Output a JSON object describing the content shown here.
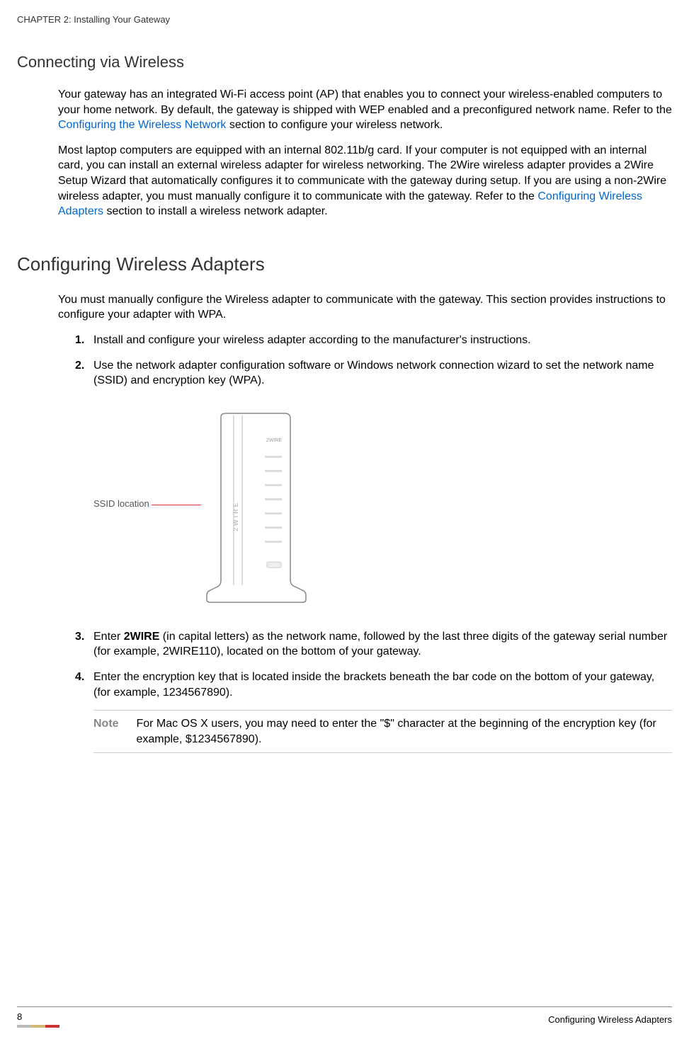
{
  "header": {
    "chapter": "CHAPTER 2: Installing Your Gateway"
  },
  "section1": {
    "title": "Connecting via Wireless",
    "para1_a": "Your gateway has an integrated Wi-Fi access point (AP) that enables you to connect your wireless-enabled computers to your home network. By default, the gateway is shipped with WEP enabled and a preconfigured network name. Refer to the ",
    "para1_link": "Configuring the Wireless Network",
    "para1_b": " section to configure your wireless network.",
    "para2_a": "Most laptop computers are equipped with an internal 802.11b/g card. If your computer is not equipped with an internal card, you can install an external wireless adapter for wireless networking. The 2Wire wireless adapter provides a 2Wire Setup Wizard that automatically configures it to communicate with the gateway during setup. If you are using a non-2Wire wireless adapter, you must manually configure it to communicate with the gateway. Refer to the ",
    "para2_link": "Configuring Wireless Adapters",
    "para2_b": " section to install a wireless network adapter."
  },
  "section2": {
    "title": "Configuring Wireless Adapters",
    "intro": "You must manually configure the Wireless adapter to communicate with the gateway. This section provides instructions to configure your adapter with WPA.",
    "steps": {
      "s1": "Install and configure your wireless adapter according to the manufacturer's instructions.",
      "s2": "Use the network adapter configuration software or Windows network connection wizard to set the network name (SSID) and encryption key (WPA).",
      "s3_a": "Enter ",
      "s3_bold": "2WIRE",
      "s3_b": " (in capital letters) as the network name, followed by the last three digits of the gateway serial number (for example, 2WIRE110), located on the bottom of your gateway.",
      "s4": "Enter the encryption key that is located inside the brackets beneath the bar code on the bottom of your gateway, (for example, 1234567890)."
    },
    "note": {
      "label": "Note",
      "text": "For Mac OS X users, you may need to enter the \"$\" character at the beginning of the encryption key (for example, $1234567890)."
    },
    "figure": {
      "ssid_label": "SSID location",
      "device_brand": "2WIRE"
    }
  },
  "footer": {
    "page": "8",
    "section": "Configuring Wireless Adapters"
  }
}
